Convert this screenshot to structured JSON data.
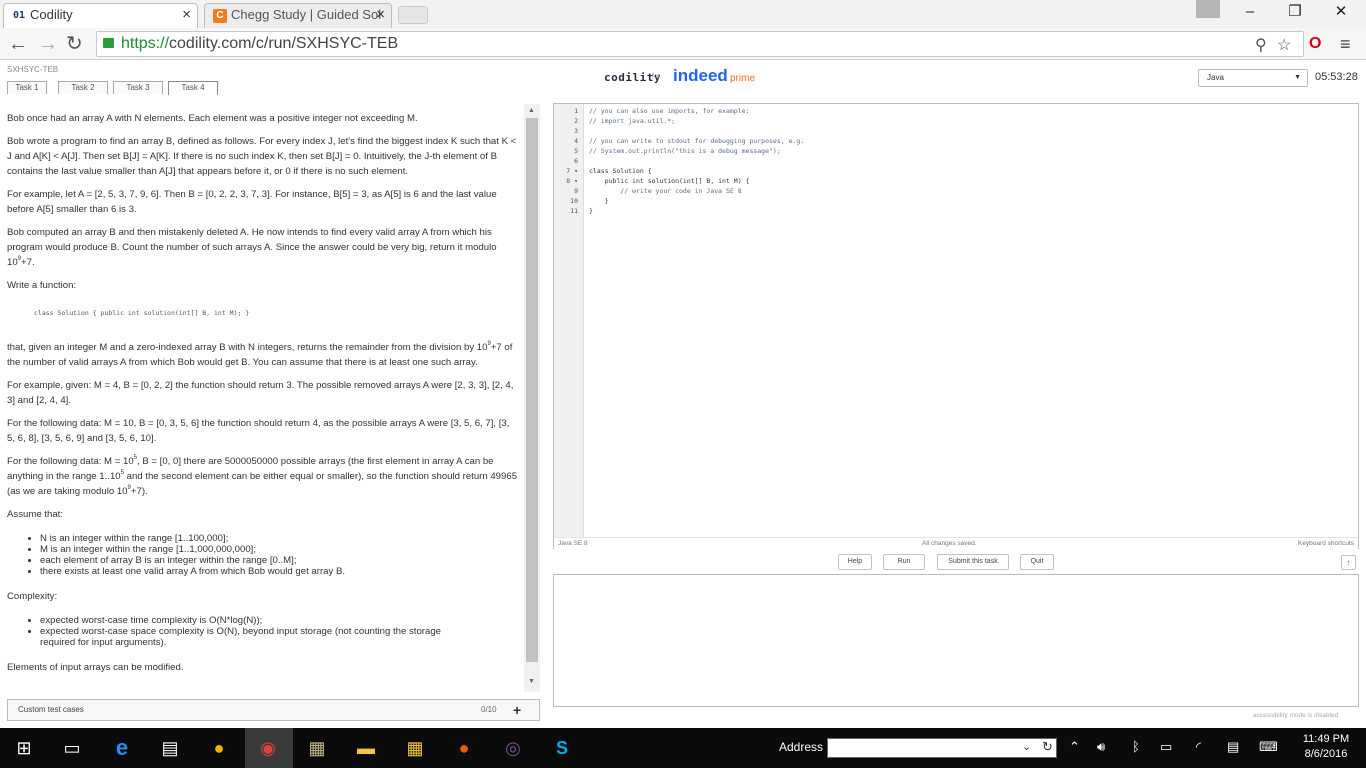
{
  "browser": {
    "tabs": [
      {
        "icon_text": "01",
        "title": "Codility"
      },
      {
        "icon_text": "C",
        "title": "Chegg Study | Guided Sol"
      }
    ],
    "url": {
      "scheme": "https://",
      "rest": "codility.com/c/run/SXHSYC-TEB"
    }
  },
  "header": {
    "task_id": "SXHSYC-TEB",
    "tasks": [
      "Task 1",
      "Task 2",
      "Task 3",
      "Task 4"
    ],
    "active_task": "Task 4",
    "brand": "codility",
    "for": "for",
    "partner": "indeed",
    "partner_suffix": "prime",
    "language": "Java",
    "timer": "05:53:28"
  },
  "task": {
    "p1": "Bob once had an array A with N elements. Each element was a positive integer not exceeding M.",
    "p2": "Bob wrote a program to find an array B, defined as follows. For every index J, let's find the biggest index K such that K < J and A[K] < A[J]. Then set B[J] = A[K]. If there is no such index K, then set B[J] = 0. Intuitively, the J-th element of B contains the last value smaller than A[J] that appears before it, or 0 if there is no such element.",
    "p3": "For example, let A = [2, 5, 3, 7, 9, 6]. Then B = [0, 2, 2, 3, 7, 3]. For instance, B[5] = 3, as A[5] is 6 and the last value before A[5] smaller than 6 is 3.",
    "p4_a": "Bob computed an array B and then mistakenly deleted A. He now intends to find every valid array A from which his program would produce B. Count the number of such arrays A. Since the answer could be very big, return it modulo 10",
    "p4_sup": "9",
    "p4_b": "+7.",
    "p5": "Write a function:",
    "signature": "class Solution { public int solution(int[] B, int M); }",
    "p6_a": "that, given an integer M and a zero-indexed array B with N integers, returns the remainder from the division by 10",
    "p6_sup": "9",
    "p6_b": "+7 of the number of valid arrays A from which Bob would get B. You can assume that there is at least one such array.",
    "p7": "For example, given: M = 4, B = [0, 2, 2] the function should return 3. The possible removed arrays A were [2, 3, 3], [2, 4, 3] and [2, 4, 4].",
    "p8": "For the following data: M = 10, B = [0, 3, 5, 6] the function should return 4, as the possible arrays A were [3, 5, 6, 7], [3, 5, 6, 8], [3, 5, 6, 9] and [3, 5, 6, 10].",
    "p9_a": "For the following data: M = 10",
    "p9_sup1": "5",
    "p9_b": ", B = [0, 0] there are 5000050000 possible arrays (the first element in array A can be anything in the range 1..10",
    "p9_sup2": "5",
    "p9_c": " and the second element can be either equal or smaller), so the function should return 49965 (as we are taking modulo 10",
    "p9_sup3": "9",
    "p9_d": "+7).",
    "assume": "Assume that:",
    "assumptions": [
      "N is an integer within the range [1..100,000];",
      "M is an integer within the range [1..1,000,000,000];",
      "each element of array B is an integer within the range [0..M];",
      "there exists at least one valid array A from which Bob would get array B."
    ],
    "complexity": "Complexity:",
    "complexities": [
      "expected worst-case time complexity is O(N*log(N));",
      "expected worst-case space complexity is O(N), beyond input storage (not counting the storage required for input arguments)."
    ],
    "modifiable": "Elements of input arrays can be modified."
  },
  "custom_tests": {
    "label": "Custom test cases",
    "count": "0/10",
    "add": "+"
  },
  "editor": {
    "lines": [
      {
        "n": "1",
        "text": "// you can also use imports, for example:"
      },
      {
        "n": "2",
        "text": "// import java.util.*;"
      },
      {
        "n": "3",
        "text": ""
      },
      {
        "n": "4",
        "text": "// you can write to stdout for debugging purposes, e.g."
      },
      {
        "n": "5",
        "text": "// System.out.println(\"this is a debug message\");"
      },
      {
        "n": "6",
        "text": ""
      },
      {
        "n": "7 ▾",
        "text": "class Solution {"
      },
      {
        "n": "8 ▾",
        "text": "    public int solution(int[] B, int M) {"
      },
      {
        "n": "9",
        "text": "        // write your code in Java SE 8"
      },
      {
        "n": "10",
        "text": "    }"
      },
      {
        "n": "11",
        "text": "}"
      }
    ],
    "status_lang": "Java SE 8",
    "status_saved": "All changes saved.",
    "status_keys": "Keyboard shortcuts"
  },
  "actions": {
    "help": "Help",
    "run": "Run",
    "submit": "Submit this task",
    "quit": "Quit"
  },
  "accessibility": "accessibility mode is disabled",
  "taskbar": {
    "address_label": "Address",
    "time": "11:49 PM",
    "date": "8/6/2016"
  }
}
